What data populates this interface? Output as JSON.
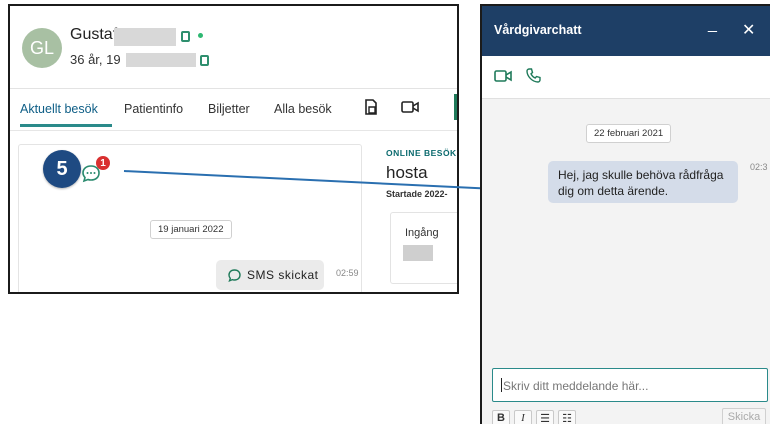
{
  "patient": {
    "initials": "GL",
    "name": "Gustaf",
    "age_line": "36 år, 19"
  },
  "tabs": [
    {
      "label": "Aktuellt besök",
      "active": true
    },
    {
      "label": "Patientinfo",
      "active": false
    },
    {
      "label": "Biljetter",
      "active": false
    },
    {
      "label": "Alla besök",
      "active": false
    }
  ],
  "visit": {
    "chat_unread_badge": "1",
    "date_chip": "19 januari 2022",
    "sms_label": "SMS skickat",
    "sms_time": "02:59",
    "category": "ONLINE BESÖK",
    "title": "hosta",
    "started": "Startade 2022-",
    "ingang_label": "Ingång"
  },
  "annotation": {
    "step_number": "5"
  },
  "chat": {
    "title": "Vårdgivarchatt",
    "minimize_glyph": "_",
    "close_glyph": "✕",
    "date_chip": "22 februari 2021",
    "message_line1": "Hej, jag skulle behöva rådfråga",
    "message_line2": "dig om detta ärende.",
    "message_time": "02:3",
    "input_placeholder": "Skriv ditt meddelande här...",
    "format_buttons": [
      "B",
      "I",
      "☰",
      "☷"
    ],
    "send_label": "Skicka"
  },
  "colors": {
    "titlebar": "#1e3f66",
    "accent_teal": "#2a8a8a",
    "step_badge": "#1e4a82",
    "badge_red": "#d93030"
  }
}
